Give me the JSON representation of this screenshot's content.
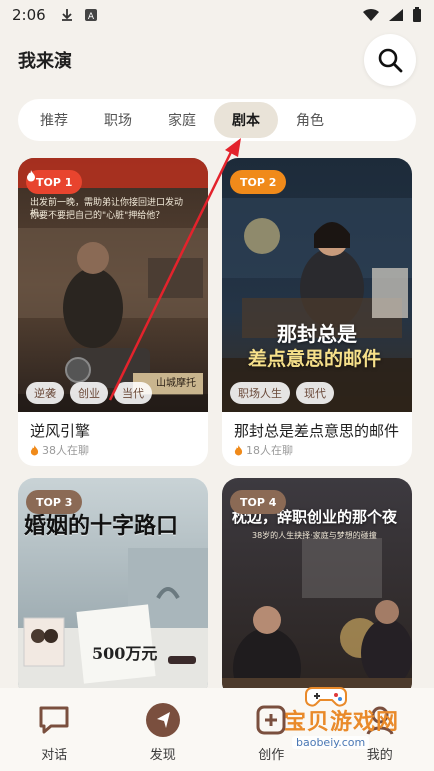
{
  "status_bar": {
    "time": "2:06"
  },
  "header": {
    "title": "我来演"
  },
  "tabs": [
    {
      "label": "推荐"
    },
    {
      "label": "职场"
    },
    {
      "label": "家庭"
    },
    {
      "label": "剧本",
      "active": true
    },
    {
      "label": "角色"
    }
  ],
  "cards": [
    {
      "rank": "TOP 1",
      "rank_color": "#e8442e",
      "title": "逆风引擎",
      "meta": "38人在聊",
      "tags": [
        "逆袭",
        "创业",
        "当代"
      ],
      "poster_lines": [
        "出发前一晚，需助弟让你接回进口发动机。",
        "你要不要把自己的\"心脏\"押给他？"
      ],
      "poster_sign": "山城摩托"
    },
    {
      "rank": "TOP 2",
      "rank_color": "#f08a1a",
      "title": "那封总是差点意思的邮件",
      "meta": "18人在聊",
      "tags": [
        "职场人生",
        "现代"
      ],
      "poster_title_1": "那封总是",
      "poster_title_2": "差点意思的邮件"
    },
    {
      "rank": "TOP 3",
      "rank_color": "#8b6a55",
      "poster_title": "婚姻的十字路口",
      "poster_amount": "500万元"
    },
    {
      "rank": "TOP 4",
      "rank_color": "#8b6a55",
      "poster_title": "枕边，辞职创业的那个夜",
      "poster_sub": "38岁的人生抉择·家庭与梦想的碰撞"
    }
  ],
  "bottom_nav": [
    {
      "label": "对话",
      "icon": "chat-icon"
    },
    {
      "label": "发现",
      "icon": "compass-icon"
    },
    {
      "label": "创作",
      "icon": "create-icon"
    },
    {
      "label": "我的",
      "icon": "profile-icon"
    }
  ],
  "watermark": {
    "text": "宝贝游戏网",
    "url": "baobeiy.com"
  },
  "colors": {
    "background": "#f4f1ec",
    "accent": "#7a4f3e",
    "annotation": "#e3232c"
  }
}
